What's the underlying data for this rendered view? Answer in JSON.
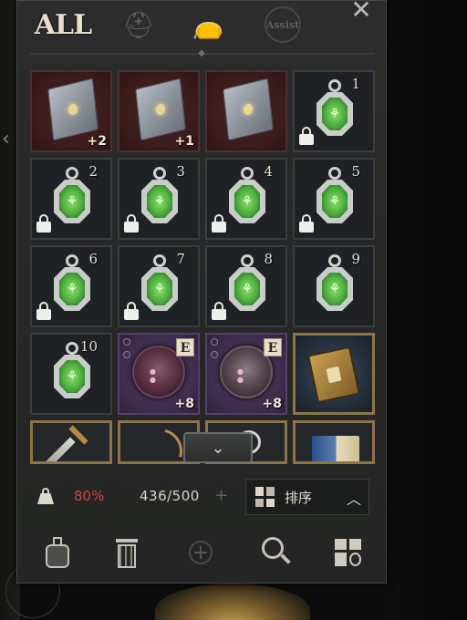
{
  "tabs": {
    "all": "ALL",
    "assist": "Assist",
    "close": "✕"
  },
  "grid": [
    {
      "kind": "tome",
      "bg": "red",
      "plus": "+2"
    },
    {
      "kind": "tome",
      "bg": "red",
      "plus": "+1"
    },
    {
      "kind": "tome",
      "bg": "red",
      "plus": ""
    },
    {
      "kind": "watch",
      "bg": "dark",
      "num": "1",
      "locked": true
    },
    {
      "kind": "watch",
      "bg": "dark",
      "num": "2",
      "locked": true
    },
    {
      "kind": "watch",
      "bg": "dark",
      "num": "3",
      "locked": true
    },
    {
      "kind": "watch",
      "bg": "dark",
      "num": "4",
      "locked": true
    },
    {
      "kind": "watch",
      "bg": "dark",
      "num": "5",
      "locked": true
    },
    {
      "kind": "watch",
      "bg": "dark",
      "num": "6",
      "locked": true
    },
    {
      "kind": "watch",
      "bg": "dark",
      "num": "7",
      "locked": true
    },
    {
      "kind": "watch",
      "bg": "dark",
      "num": "8",
      "locked": true
    },
    {
      "kind": "watch",
      "bg": "dark",
      "num": "9",
      "locked": false
    },
    {
      "kind": "watch",
      "bg": "dark",
      "num": "10",
      "locked": false
    },
    {
      "kind": "beast",
      "bg": "purple",
      "badge": "E",
      "plus": "+8"
    },
    {
      "kind": "skull",
      "bg": "purple",
      "badge": "E",
      "plus": "+8"
    },
    {
      "kind": "book",
      "bg": "gold-book"
    },
    {
      "kind": "sword",
      "bg": "gold"
    },
    {
      "kind": "bow",
      "bg": "gold"
    },
    {
      "kind": "knot",
      "bg": "gold"
    },
    {
      "kind": "scroll",
      "bg": "gold"
    }
  ],
  "expand_glyph": "⌄",
  "stats": {
    "weight_percent": "80%",
    "capacity": "436/500",
    "capacity_plus": "+",
    "sort_label": "排序",
    "sort_caret": "︿"
  },
  "toolbar": {
    "plus": "+"
  },
  "icons": [
    "helmet-icon",
    "bag-icon",
    "assist-icon",
    "close-icon",
    "lock-icon",
    "weight-icon",
    "sort-icon",
    "potion-icon",
    "trash-icon",
    "add-icon",
    "search-icon",
    "grid-icon"
  ],
  "colors": {
    "weight_warn": "#c8483e",
    "gold_frame": "#8c7548",
    "rare_purple": "#4c3a5c",
    "locked_red": "#3a1a1b"
  }
}
